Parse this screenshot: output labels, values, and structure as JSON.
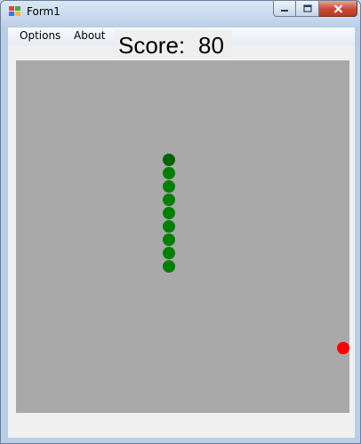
{
  "window": {
    "title": "Form1",
    "caption_buttons": {
      "minimize_icon": "minimize-icon",
      "maximize_icon": "maximize-icon",
      "close_icon": "close-icon"
    }
  },
  "menu": {
    "items": [
      {
        "label": "Options"
      },
      {
        "label": "About"
      }
    ]
  },
  "score": {
    "label": "Score:",
    "value": "80"
  },
  "game": {
    "board_color": "#a9a9a9",
    "snake_color": "#008000",
    "snake_head_color": "#006400",
    "food_color": "#ff0000",
    "grid_cell_size": 15,
    "snake_segments": [
      {
        "col": 11,
        "row": 7
      },
      {
        "col": 11,
        "row": 8
      },
      {
        "col": 11,
        "row": 9
      },
      {
        "col": 11,
        "row": 10
      },
      {
        "col": 11,
        "row": 11
      },
      {
        "col": 11,
        "row": 12
      },
      {
        "col": 11,
        "row": 13
      },
      {
        "col": 11,
        "row": 14
      },
      {
        "col": 11,
        "row": 15
      }
    ],
    "food": {
      "col": 24,
      "row": 21
    }
  }
}
